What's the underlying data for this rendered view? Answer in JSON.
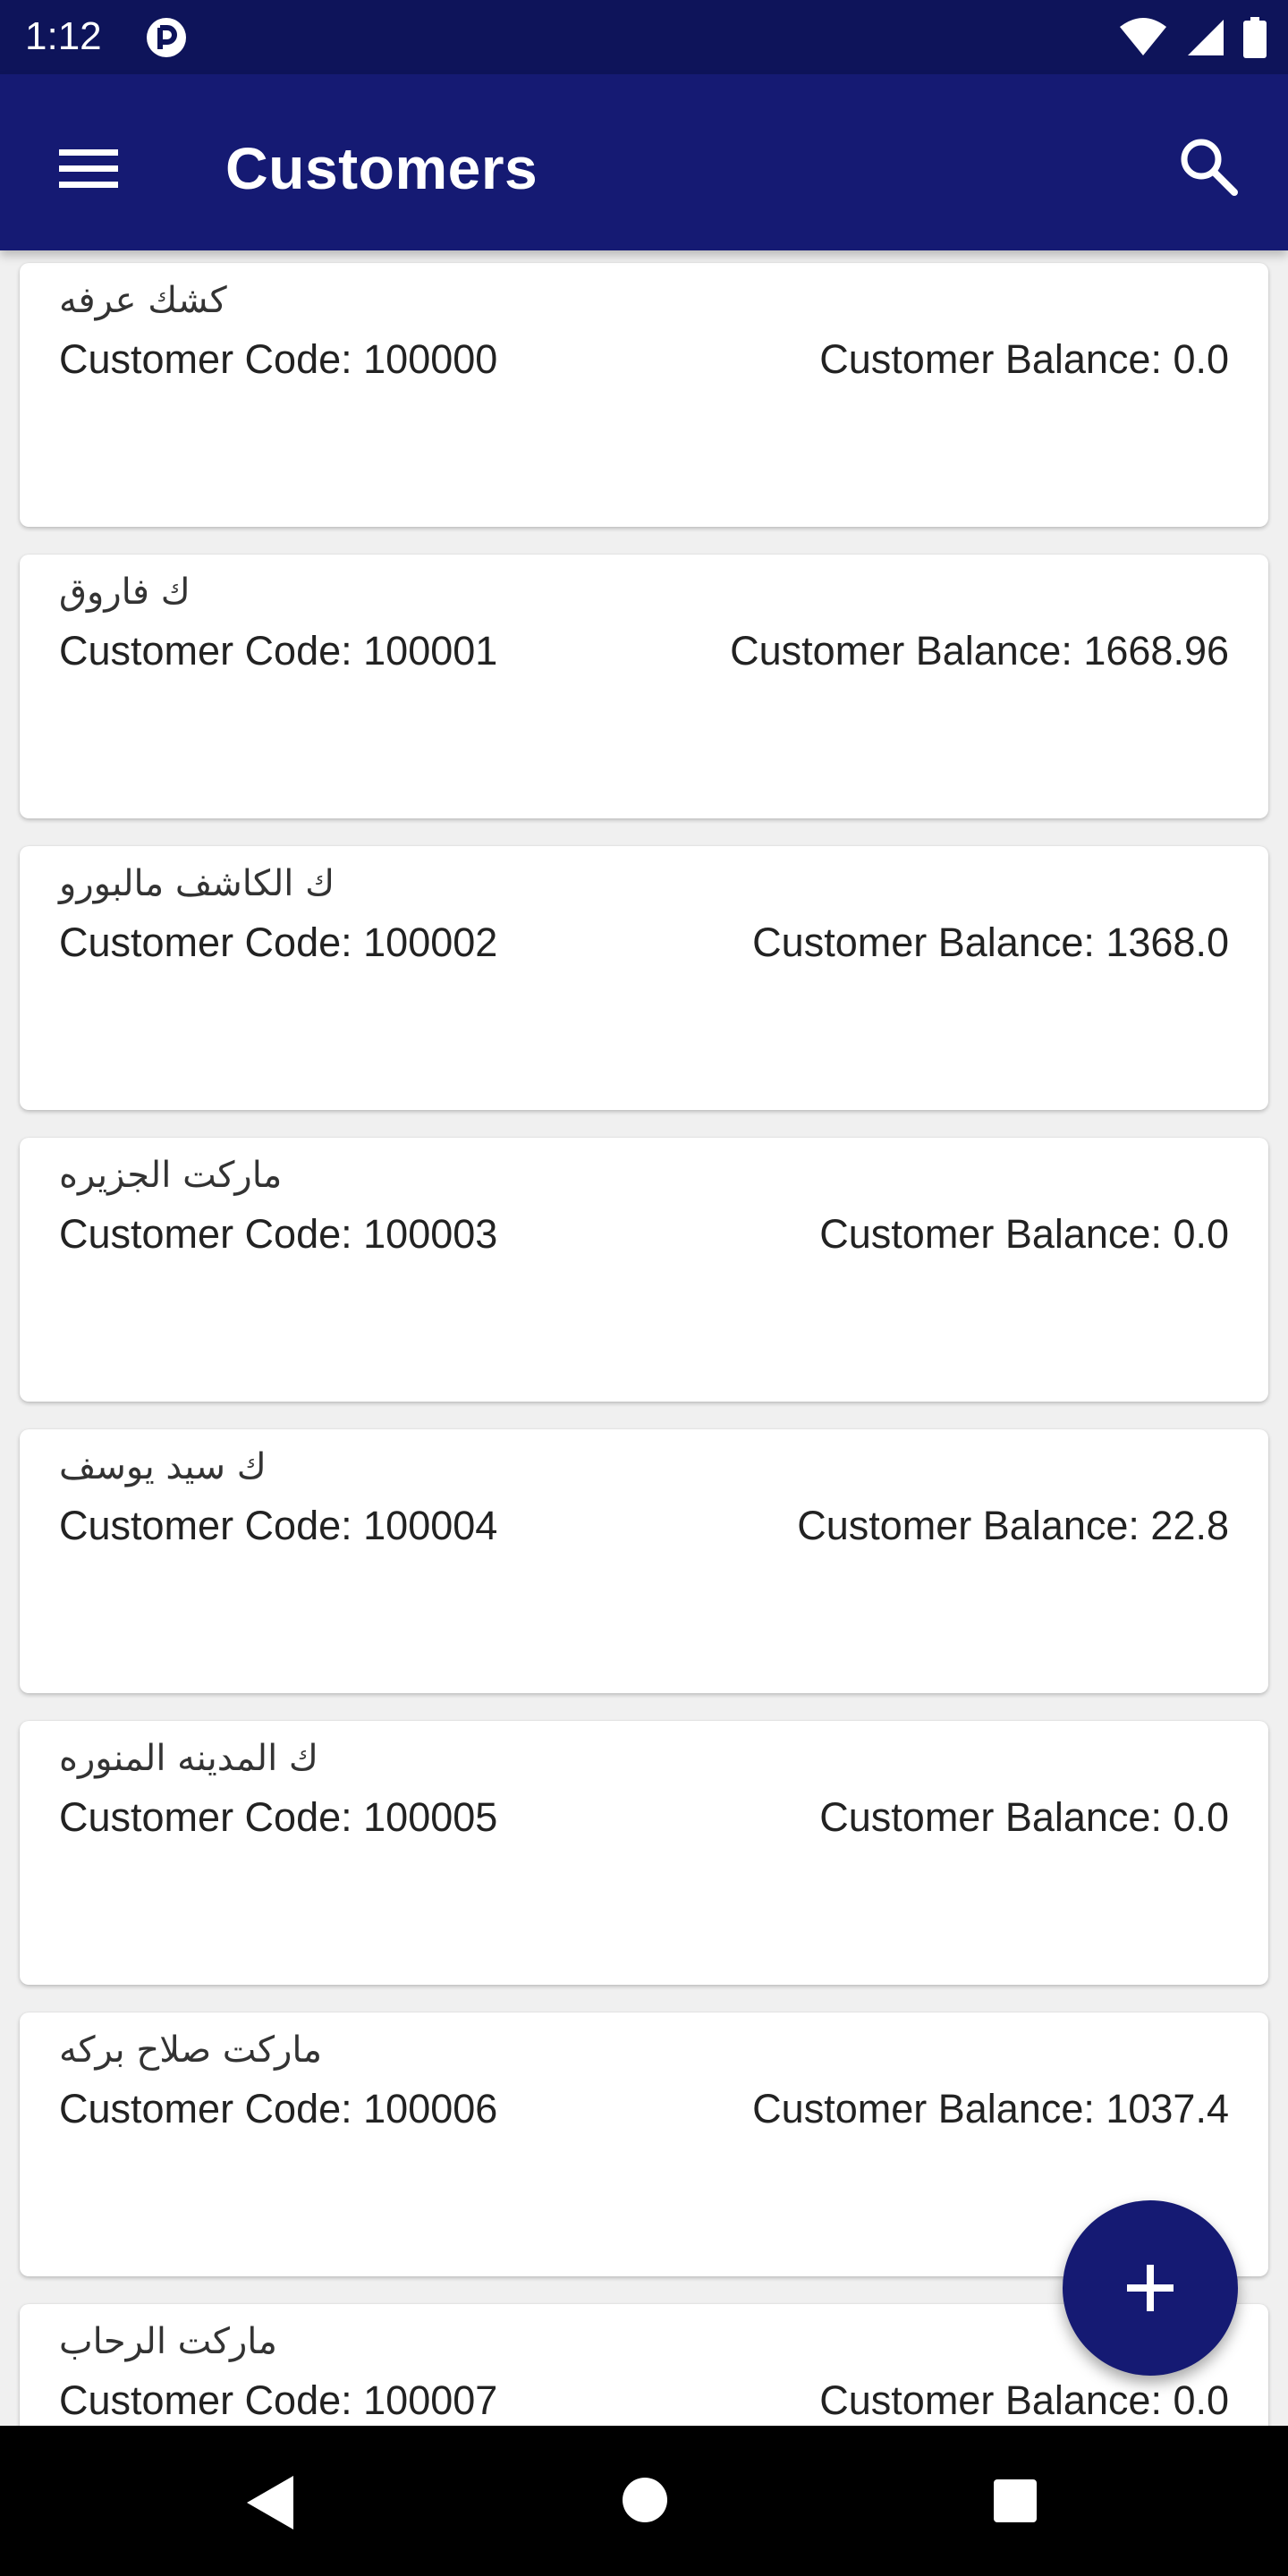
{
  "status_bar": {
    "time": "1:12",
    "icons": [
      "app-notification-icon",
      "wifi-icon",
      "signal-icon",
      "battery-icon"
    ]
  },
  "app_bar": {
    "title": "Customers",
    "menu_icon": "menu-icon",
    "search_icon": "search-icon",
    "color": "#151a73"
  },
  "customers": [
    {
      "name": "كشك عرفه",
      "code": "Customer Code: 100000",
      "balance": "Customer Balance: 0.0"
    },
    {
      "name": "ك فاروق",
      "code": "Customer Code: 100001",
      "balance": "Customer Balance: 1668.96"
    },
    {
      "name": "ك الكاشف مالبورو",
      "code": "Customer Code: 100002",
      "balance": "Customer Balance: 1368.0"
    },
    {
      "name": "ماركت الجزيره",
      "code": "Customer Code: 100003",
      "balance": "Customer Balance: 0.0"
    },
    {
      "name": "ك سيد يوسف",
      "code": "Customer Code: 100004",
      "balance": "Customer Balance: 22.8"
    },
    {
      "name": "ك المدينه المنوره",
      "code": "Customer Code: 100005",
      "balance": "Customer Balance: 0.0"
    },
    {
      "name": "ماركت صلاح بركه",
      "code": "Customer Code: 100006",
      "balance": "Customer Balance: 1037.4"
    },
    {
      "name": "ماركت الرحاب",
      "code": "Customer Code: 100007",
      "balance": "Customer Balance: 0.0"
    }
  ],
  "fab": {
    "icon": "plus-icon"
  },
  "nav_bar": {
    "icons": [
      "back-icon",
      "home-icon",
      "recents-icon"
    ]
  }
}
